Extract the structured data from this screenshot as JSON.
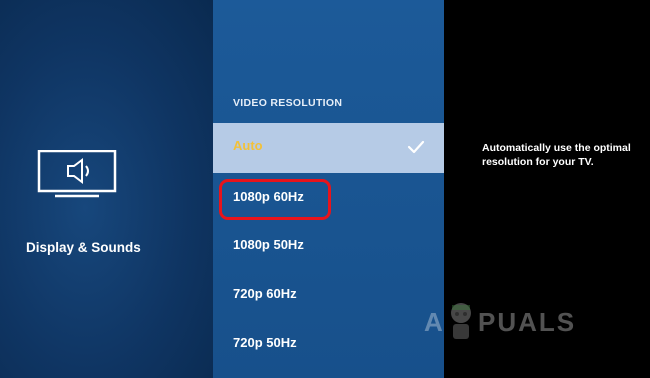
{
  "category": {
    "icon": "speaker-display-icon",
    "label": "Display & Sounds"
  },
  "menu": {
    "header": "VIDEO RESOLUTION",
    "items": [
      {
        "label": "Auto",
        "selected": true
      },
      {
        "label": "1080p 60Hz",
        "selected": false
      },
      {
        "label": "1080p 50Hz",
        "selected": false
      },
      {
        "label": "720p 60Hz",
        "selected": false
      },
      {
        "label": "720p 50Hz",
        "selected": false
      }
    ],
    "highlighted_item": "1080p 60Hz"
  },
  "help": {
    "text": "Automatically use the optimal resolution for your TV."
  },
  "watermark": {
    "text_left": "A",
    "text_right": "PUALS"
  },
  "colors": {
    "selected_text": "#f2c13a",
    "selected_bg": "#b6cbe6",
    "highlight_ring": "#e8141b",
    "menu_bg": "#1a5693",
    "left_bg": "#0f3563",
    "right_bg": "#000000"
  }
}
